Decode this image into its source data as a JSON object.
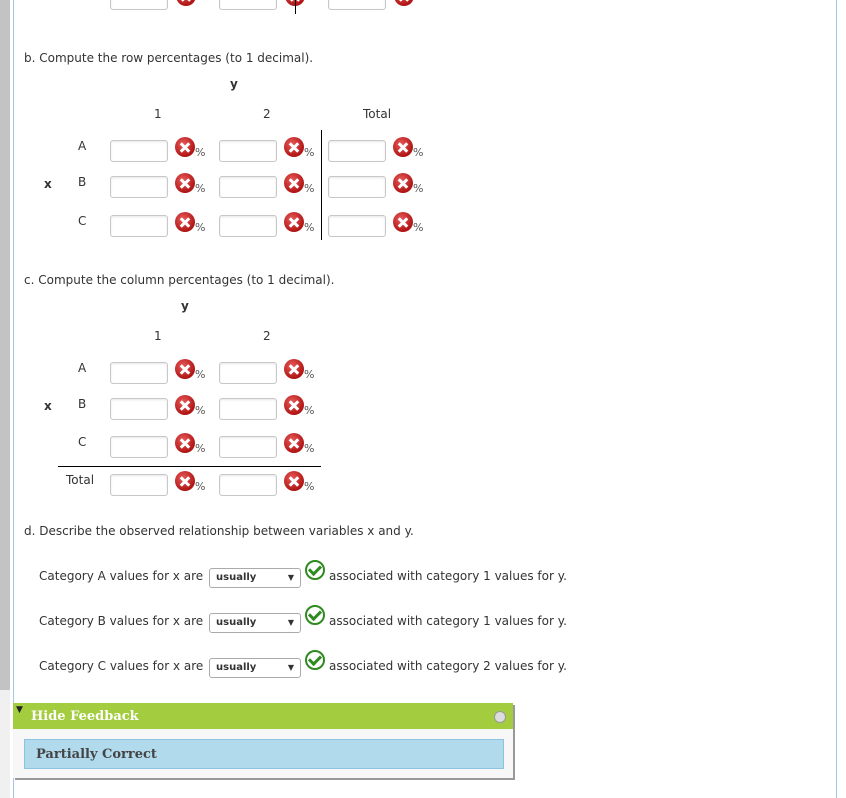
{
  "part_b": {
    "title": "b. Compute the row percentages (to 1 decimal).",
    "col_var": "y",
    "row_var": "x",
    "headers": [
      "1",
      "2",
      "Total"
    ],
    "rows": [
      "A",
      "B",
      "C"
    ],
    "unit": "%"
  },
  "part_c": {
    "title": "c. Compute the column percentages (to 1 decimal).",
    "col_var": "y",
    "row_var": "x",
    "headers": [
      "1",
      "2"
    ],
    "rows": [
      "A",
      "B",
      "C",
      "Total"
    ],
    "unit": "%"
  },
  "part_d": {
    "title": "d. Describe the observed relationship between variables x and y.",
    "items": [
      {
        "prefix": "Category A values for x are",
        "selected": "usually",
        "suffix": "associated with category 1 values for y."
      },
      {
        "prefix": "Category B values for x are",
        "selected": "usually",
        "suffix": "associated with category 1 values for y."
      },
      {
        "prefix": "Category C values for x are",
        "selected": "usually",
        "suffix": "associated with category 2 values for y."
      }
    ]
  },
  "feedback": {
    "toggle_label": "Hide Feedback",
    "status": "Partially Correct"
  },
  "colors": {
    "incorrect": "#b01515",
    "correct": "#2f8a1f",
    "feedback_header": "#a3cc3f",
    "feedback_status": "#b2daed"
  }
}
